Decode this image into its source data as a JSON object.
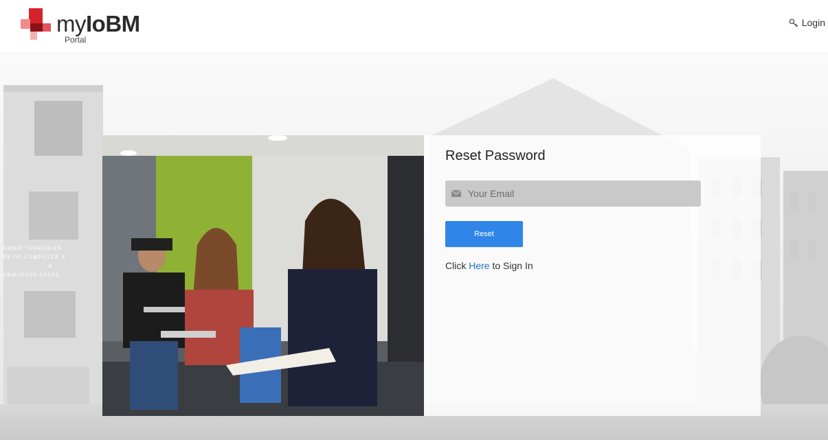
{
  "header": {
    "logo_prefix": "my",
    "logo_brand": "IoBM",
    "logo_sub": "Portal",
    "login_label": "Login",
    "login_icon": "key-icon"
  },
  "background": {
    "sign_lines": [
      "ABHIR JANMOHAN",
      "DE OF COMPUTER S",
      "&",
      "ORMATION SYSTE"
    ]
  },
  "reset_panel": {
    "title": "Reset Password",
    "email_placeholder": "Your Email",
    "email_value": "",
    "email_icon": "envelope-icon",
    "reset_label": "Reset",
    "signin_prefix": "Click",
    "signin_link": "Here",
    "signin_suffix": "to Sign In"
  },
  "colors": {
    "brand_red": "#d6222a",
    "brand_pink": "#f08a8d",
    "button_blue": "#2f86e8",
    "link_blue": "#1f6fd1",
    "input_gray": "#c9c9c9"
  }
}
